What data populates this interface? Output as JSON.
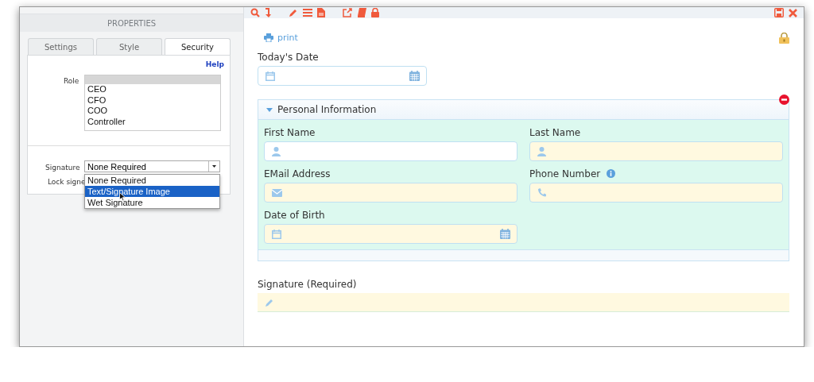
{
  "properties_panel": {
    "title": "PROPERTIES",
    "tabs": [
      {
        "label": "Settings",
        "selected": false
      },
      {
        "label": "Style",
        "selected": false
      },
      {
        "label": "Security",
        "selected": true
      }
    ],
    "help_link": "Help",
    "role": {
      "label": "Role",
      "blank_selected": true,
      "options": [
        {
          "label": "CEO",
          "selected": false
        },
        {
          "label": "CFO",
          "selected": false
        },
        {
          "label": "COO",
          "selected": false
        },
        {
          "label": "Controller",
          "selected": false
        }
      ]
    },
    "signature": {
      "label": "Signature",
      "value": "None Required",
      "open": true,
      "options": [
        {
          "label": "None Required",
          "highlighted": false
        },
        {
          "label": "Text/Signature Image",
          "highlighted": true
        },
        {
          "label": "Wet Signature",
          "highlighted": false
        }
      ]
    },
    "lock_label": "Lock signe"
  },
  "form": {
    "print_link": "print",
    "locked": true,
    "todays_date": {
      "label": "Today's Date",
      "kind": "date",
      "highlighted": false
    },
    "section": {
      "title": "Personal Information",
      "expanded": true,
      "removable": true,
      "fields": [
        {
          "label": "First Name",
          "kind": "person",
          "highlighted": false,
          "info": false
        },
        {
          "label": "Last Name",
          "kind": "person",
          "highlighted": true,
          "info": false
        },
        {
          "label": "EMail Address",
          "kind": "email",
          "highlighted": true,
          "info": false
        },
        {
          "label": "Phone Number",
          "kind": "phone",
          "highlighted": true,
          "info": true
        },
        {
          "label": "Date of Birth",
          "kind": "date",
          "highlighted": true,
          "info": false
        }
      ]
    },
    "signature_field": {
      "label": "Signature (Required)",
      "kind": "signature",
      "highlighted": true
    }
  }
}
